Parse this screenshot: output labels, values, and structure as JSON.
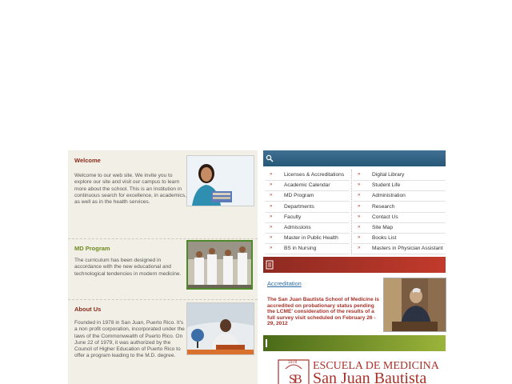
{
  "welcome": {
    "title": "Welcome",
    "body": "Welcome to our web site. We invite you to explore our site and visit our campus to learn more about the school. This is an Institution in continuous search for excellence, in academics, as well as in the health services."
  },
  "md_program": {
    "title": "MD Program",
    "body": "The curriculum has been designed in accordance with the new educational and technological tendencies in modern medicine."
  },
  "about": {
    "title": "About Us",
    "body": "Founded in 1978 in San Juan, Puerto Rico. It's a non profit corporation, incorporated under the laws of the Commonwealth of Puerto Rico. On June 22 of 1979, it was authorized by the Council of Higher Education of Puerto Rico to offer a program leading to the M.D. degree."
  },
  "menu": {
    "arrow": "»",
    "left": [
      "Licenses & Accreditations",
      "Academic Calendar",
      "MD Program",
      "Departments",
      "Faculty",
      "Admissions",
      "Master in Public Health",
      "BS in Nursing"
    ],
    "right": [
      "Digital Library",
      "Student Life",
      "Administration",
      "Research",
      "Contact Us",
      "Site Map",
      "Books List",
      "Masters in Physician Assistant"
    ]
  },
  "news": {
    "link": "Accreditation",
    "text": "The San Juan Bautista School of Medicine is accredited on probationary status pending the LCME' consideration of the results of a full survey visit scheduled on February  26 - 29,  2012"
  },
  "logo": {
    "year": "1978",
    "line1": "ESCUELA DE MEDICINA",
    "line2": "San Juan Bautista"
  },
  "colors": {
    "welcome_title": "#8a2a1a",
    "md_title": "#6f8a1f",
    "about_title": "#8a2a1a",
    "brand_red": "#a8322a"
  }
}
